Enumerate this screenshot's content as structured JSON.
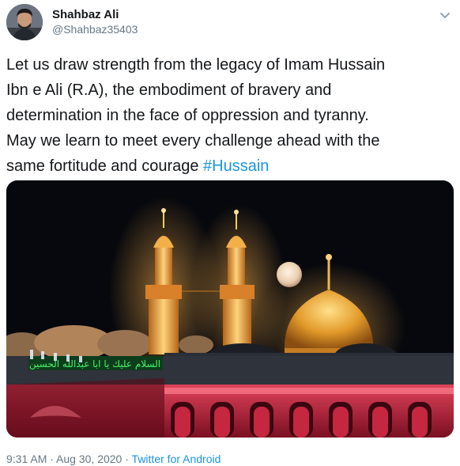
{
  "user": {
    "display_name": "Shahbaz Ali",
    "handle": "@Shahbaz35403"
  },
  "tweet": {
    "lines": [
      "Let us draw strength from the legacy of Imam Hussain",
      "Ibn e Ali (R.A), the embodiment of bravery and",
      "determination in the face of oppression and tyranny.",
      "May we learn to meet every challenge ahead with the",
      "same fortitude and courage "
    ],
    "hashtag": "#Hussain",
    "image_text": "السلام عليك يا ابا عبدالله الحسين"
  },
  "meta": {
    "time": "9:31 AM",
    "separator_1": " · ",
    "date": "Aug 30, 2020",
    "separator_2": " · ",
    "source": "Twitter for Android"
  },
  "icons": {
    "more": "chevron-down-icon"
  },
  "colors": {
    "link": "#1b95e0",
    "secondary_text": "#657786",
    "primary_text": "#14171a"
  }
}
